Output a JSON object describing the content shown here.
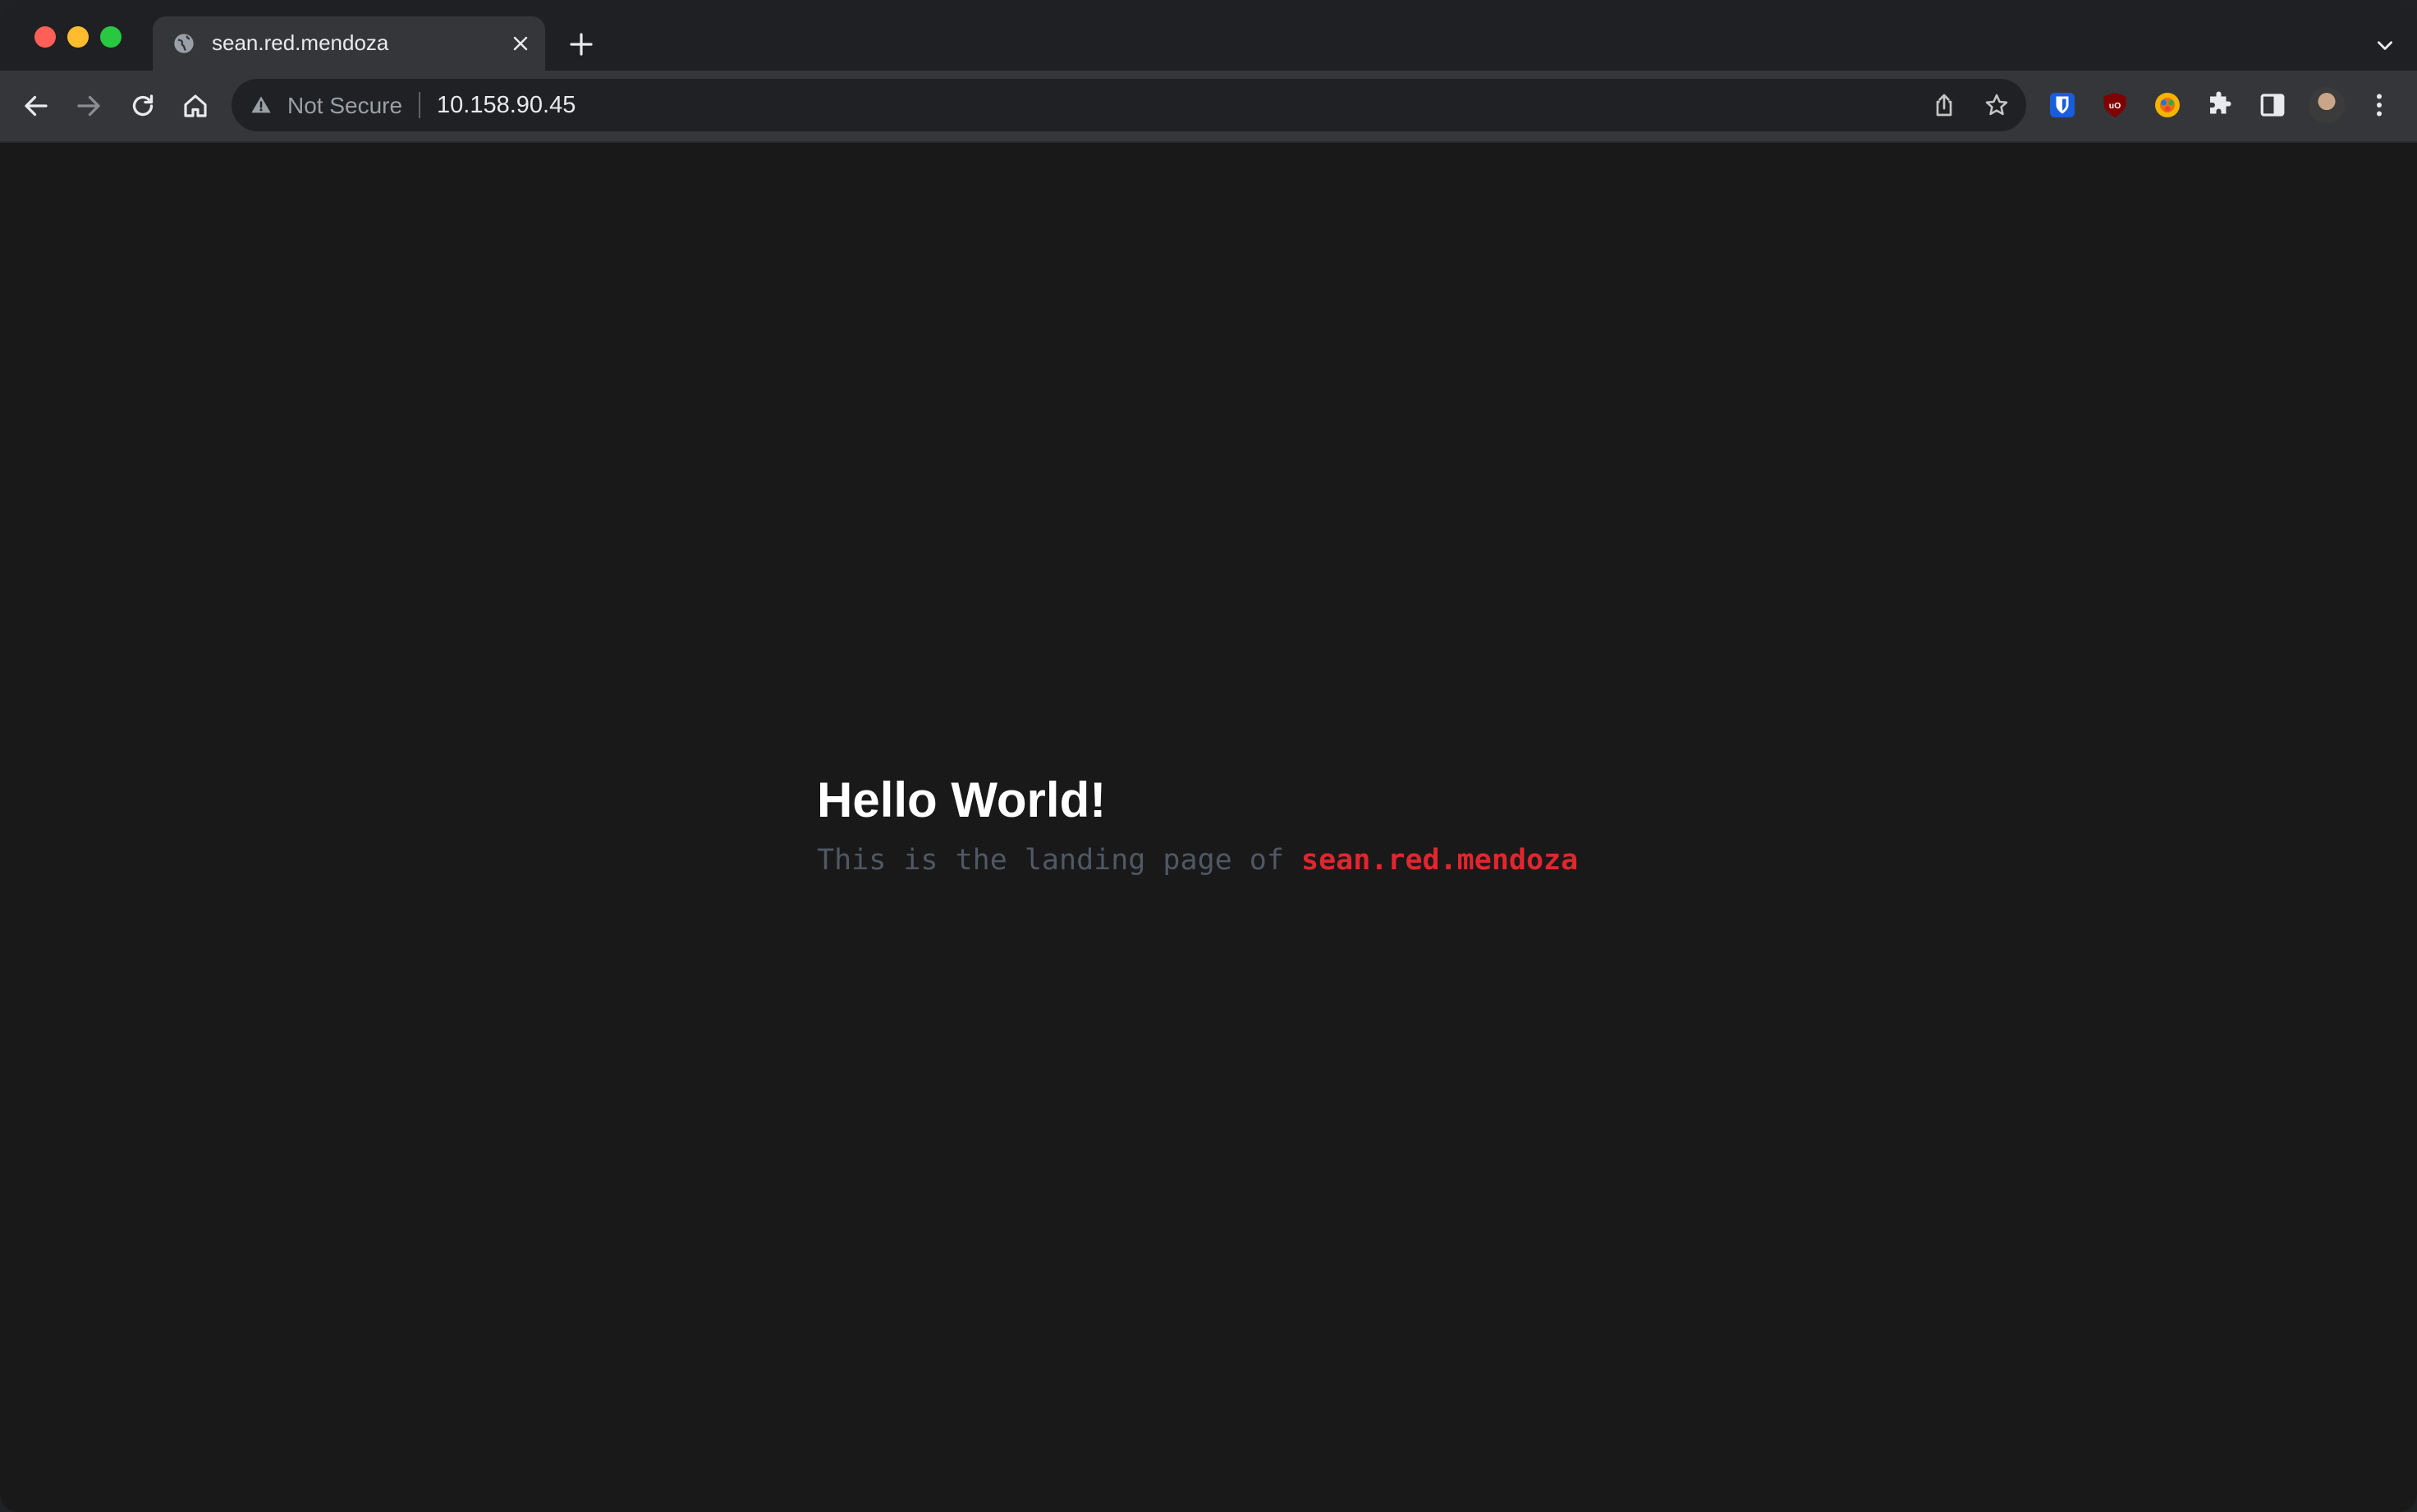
{
  "tab": {
    "title": "sean.red.mendoza",
    "favicon": "globe-icon"
  },
  "toolbar": {
    "security_label": "Not Secure",
    "url": "10.158.90.45"
  },
  "extensions": [
    "bitwarden-icon",
    "ublock-origin-icon",
    "colorful-extension-icon",
    "puzzle-icon",
    "side-panel-icon"
  ],
  "colors": {
    "accent_name": "#e0262e",
    "subtle_text": "#4f5864",
    "background": "#191919"
  },
  "page": {
    "heading": "Hello World!",
    "intro": "This is the landing page of",
    "name": "sean.red.mendoza"
  }
}
